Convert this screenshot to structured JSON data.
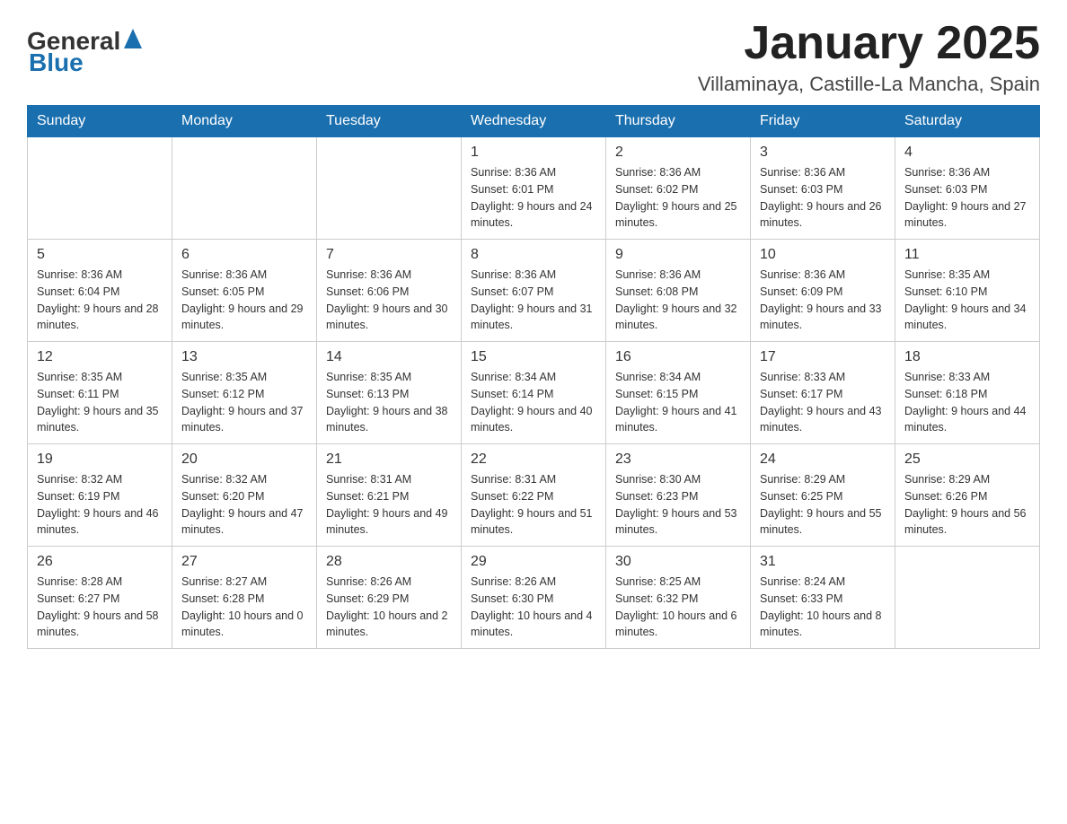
{
  "header": {
    "logo_general": "General",
    "logo_blue": "Blue",
    "month_title": "January 2025",
    "location": "Villaminaya, Castille-La Mancha, Spain"
  },
  "calendar": {
    "days_of_week": [
      "Sunday",
      "Monday",
      "Tuesday",
      "Wednesday",
      "Thursday",
      "Friday",
      "Saturday"
    ],
    "weeks": [
      [
        {
          "day": "",
          "info": ""
        },
        {
          "day": "",
          "info": ""
        },
        {
          "day": "",
          "info": ""
        },
        {
          "day": "1",
          "info": "Sunrise: 8:36 AM\nSunset: 6:01 PM\nDaylight: 9 hours and 24 minutes."
        },
        {
          "day": "2",
          "info": "Sunrise: 8:36 AM\nSunset: 6:02 PM\nDaylight: 9 hours and 25 minutes."
        },
        {
          "day": "3",
          "info": "Sunrise: 8:36 AM\nSunset: 6:03 PM\nDaylight: 9 hours and 26 minutes."
        },
        {
          "day": "4",
          "info": "Sunrise: 8:36 AM\nSunset: 6:03 PM\nDaylight: 9 hours and 27 minutes."
        }
      ],
      [
        {
          "day": "5",
          "info": "Sunrise: 8:36 AM\nSunset: 6:04 PM\nDaylight: 9 hours and 28 minutes."
        },
        {
          "day": "6",
          "info": "Sunrise: 8:36 AM\nSunset: 6:05 PM\nDaylight: 9 hours and 29 minutes."
        },
        {
          "day": "7",
          "info": "Sunrise: 8:36 AM\nSunset: 6:06 PM\nDaylight: 9 hours and 30 minutes."
        },
        {
          "day": "8",
          "info": "Sunrise: 8:36 AM\nSunset: 6:07 PM\nDaylight: 9 hours and 31 minutes."
        },
        {
          "day": "9",
          "info": "Sunrise: 8:36 AM\nSunset: 6:08 PM\nDaylight: 9 hours and 32 minutes."
        },
        {
          "day": "10",
          "info": "Sunrise: 8:36 AM\nSunset: 6:09 PM\nDaylight: 9 hours and 33 minutes."
        },
        {
          "day": "11",
          "info": "Sunrise: 8:35 AM\nSunset: 6:10 PM\nDaylight: 9 hours and 34 minutes."
        }
      ],
      [
        {
          "day": "12",
          "info": "Sunrise: 8:35 AM\nSunset: 6:11 PM\nDaylight: 9 hours and 35 minutes."
        },
        {
          "day": "13",
          "info": "Sunrise: 8:35 AM\nSunset: 6:12 PM\nDaylight: 9 hours and 37 minutes."
        },
        {
          "day": "14",
          "info": "Sunrise: 8:35 AM\nSunset: 6:13 PM\nDaylight: 9 hours and 38 minutes."
        },
        {
          "day": "15",
          "info": "Sunrise: 8:34 AM\nSunset: 6:14 PM\nDaylight: 9 hours and 40 minutes."
        },
        {
          "day": "16",
          "info": "Sunrise: 8:34 AM\nSunset: 6:15 PM\nDaylight: 9 hours and 41 minutes."
        },
        {
          "day": "17",
          "info": "Sunrise: 8:33 AM\nSunset: 6:17 PM\nDaylight: 9 hours and 43 minutes."
        },
        {
          "day": "18",
          "info": "Sunrise: 8:33 AM\nSunset: 6:18 PM\nDaylight: 9 hours and 44 minutes."
        }
      ],
      [
        {
          "day": "19",
          "info": "Sunrise: 8:32 AM\nSunset: 6:19 PM\nDaylight: 9 hours and 46 minutes."
        },
        {
          "day": "20",
          "info": "Sunrise: 8:32 AM\nSunset: 6:20 PM\nDaylight: 9 hours and 47 minutes."
        },
        {
          "day": "21",
          "info": "Sunrise: 8:31 AM\nSunset: 6:21 PM\nDaylight: 9 hours and 49 minutes."
        },
        {
          "day": "22",
          "info": "Sunrise: 8:31 AM\nSunset: 6:22 PM\nDaylight: 9 hours and 51 minutes."
        },
        {
          "day": "23",
          "info": "Sunrise: 8:30 AM\nSunset: 6:23 PM\nDaylight: 9 hours and 53 minutes."
        },
        {
          "day": "24",
          "info": "Sunrise: 8:29 AM\nSunset: 6:25 PM\nDaylight: 9 hours and 55 minutes."
        },
        {
          "day": "25",
          "info": "Sunrise: 8:29 AM\nSunset: 6:26 PM\nDaylight: 9 hours and 56 minutes."
        }
      ],
      [
        {
          "day": "26",
          "info": "Sunrise: 8:28 AM\nSunset: 6:27 PM\nDaylight: 9 hours and 58 minutes."
        },
        {
          "day": "27",
          "info": "Sunrise: 8:27 AM\nSunset: 6:28 PM\nDaylight: 10 hours and 0 minutes."
        },
        {
          "day": "28",
          "info": "Sunrise: 8:26 AM\nSunset: 6:29 PM\nDaylight: 10 hours and 2 minutes."
        },
        {
          "day": "29",
          "info": "Sunrise: 8:26 AM\nSunset: 6:30 PM\nDaylight: 10 hours and 4 minutes."
        },
        {
          "day": "30",
          "info": "Sunrise: 8:25 AM\nSunset: 6:32 PM\nDaylight: 10 hours and 6 minutes."
        },
        {
          "day": "31",
          "info": "Sunrise: 8:24 AM\nSunset: 6:33 PM\nDaylight: 10 hours and 8 minutes."
        },
        {
          "day": "",
          "info": ""
        }
      ]
    ]
  }
}
